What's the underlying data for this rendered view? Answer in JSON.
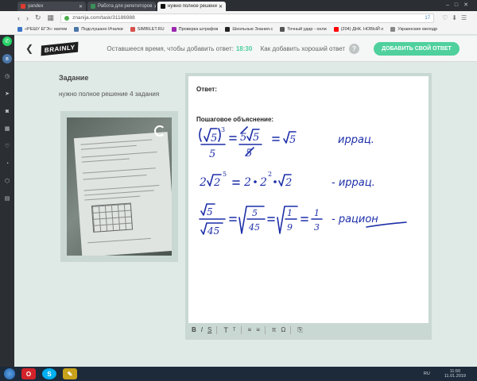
{
  "browser": {
    "tabs": [
      {
        "label": "yandex",
        "active": false,
        "color": "#e03a2f"
      },
      {
        "label": "Работа для репетиторов",
        "active": false,
        "color": "#3a8f5a"
      },
      {
        "label": "нужно полное решени",
        "active": true,
        "color": "#111111"
      }
    ],
    "url": "znanija.com/task/31186988",
    "extension_count": "17",
    "bookmarks": [
      {
        "label": "«РЕШУ ЕГЭ»: матем",
        "color": "#3b74c7"
      },
      {
        "label": "Подслушано Ичалки",
        "color": "#4a76a8"
      },
      {
        "label": "SIMBILET.RU",
        "color": "#d8504d"
      },
      {
        "label": "Проверка штрафов",
        "color": "#9c27b0"
      },
      {
        "label": "Школьные Знания.c",
        "color": "#222222"
      },
      {
        "label": "Точный удар - онли",
        "color": "#555555"
      },
      {
        "label": "(204) ДНК. НОВЫЙ о",
        "color": "#ff0000"
      },
      {
        "label": "Украинские мелодр",
        "color": "#888888"
      }
    ]
  },
  "header": {
    "logo": "BRAINLY",
    "timer_label": "Оставшееся время, чтобы добавить ответ:",
    "timer_value": "18:30",
    "howto_label": "Как добавить хороший ответ",
    "help_symbol": "?",
    "add_answer_label": "ДОБАВИТЬ СВОЙ ОТВЕТ"
  },
  "task": {
    "title": "Задание",
    "text": "нужно полное решение 4 задания"
  },
  "answer": {
    "answer_label": "Ответ:",
    "explanation_label": "Пошаговое объяснение:",
    "handwriting": {
      "line1_word": "иррац.",
      "line2_word": "- иррац.",
      "line3_word": "- рацион"
    }
  },
  "toolbar": {
    "bold": "B",
    "italic": "I",
    "underline": "S",
    "text_size_large": "T",
    "text_size_small": "T",
    "list1": "≡",
    "list2": "≡",
    "pi": "π",
    "omega": "Ω",
    "attach": "⎘"
  },
  "taskbar": {
    "lang": "RU",
    "time": "11:50",
    "date": "11.01.2019"
  },
  "colors": {
    "accent": "#4fd09d",
    "ink": "#1c2ea8",
    "panel": "#c9d8d3"
  }
}
